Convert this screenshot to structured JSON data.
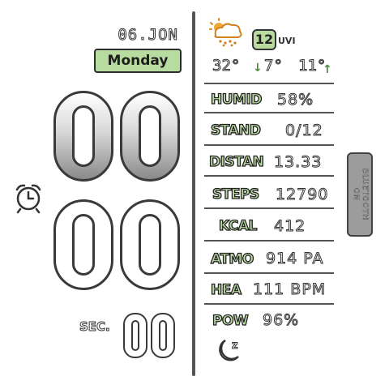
{
  "date": {
    "text": "06.JON",
    "day": "Monday"
  },
  "time": {
    "hours": "00",
    "minutes": "00",
    "seconds": "00",
    "sec_label": "SEC."
  },
  "weather": {
    "icon": "cloud-snow-sun-icon",
    "uv": "12",
    "uv_label": "UVI",
    "temp": "32°",
    "low": "7°",
    "high": "11°"
  },
  "stats": [
    {
      "label": "HUMID",
      "value": "58%"
    },
    {
      "label": "STAND",
      "value": "0/12"
    },
    {
      "label": "DISTAN",
      "value": "13.33"
    },
    {
      "label": "STEPS",
      "value": "12790"
    },
    {
      "label": "KCAL",
      "value": "412"
    },
    {
      "label": "ATMO",
      "value": "914 PA"
    },
    {
      "label": "HEA",
      "value": "111 BPM"
    },
    {
      "label": "POW",
      "value": "96%"
    }
  ],
  "bluetooth": {
    "line1": "BLUETOOTH",
    "line2": "ON"
  },
  "colors": {
    "accent": "#b8dba0",
    "outline": "#333333"
  }
}
